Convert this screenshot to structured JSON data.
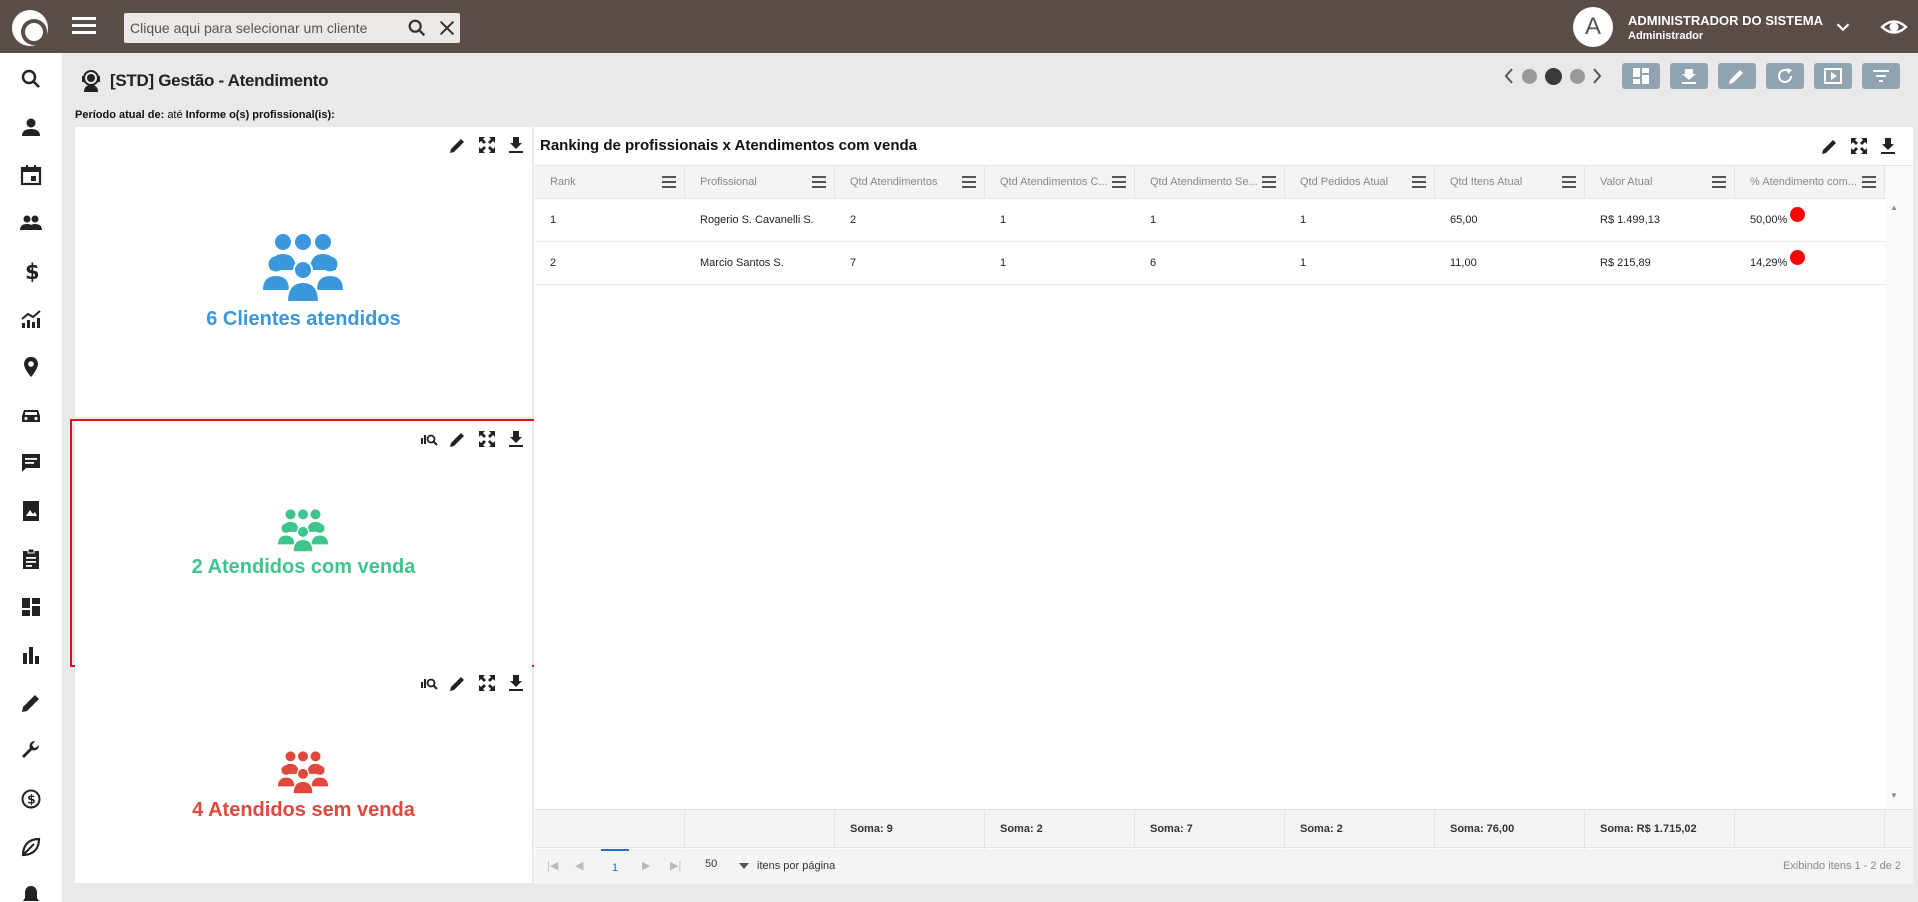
{
  "topbar": {
    "search_placeholder": "Clique aqui para selecionar um cliente",
    "avatar_letter": "A",
    "user_name": "ADMINISTRADOR DO SISTEMA",
    "user_role": "Administrador"
  },
  "header": {
    "title": "[STD] Gestão - Atendimento",
    "period_label": "Período atual de:",
    "period_until": "até",
    "professional_label": "Informe o(s) profissional(is):"
  },
  "kpis": [
    {
      "text": "6 Clientes atendidos",
      "color": "#3a97dc"
    },
    {
      "text": "2 Atendidos com venda",
      "color": "#3ec48d"
    },
    {
      "text": "4 Atendidos sem venda",
      "color": "#e0483d"
    }
  ],
  "table": {
    "title": "Ranking de profissionais x Atendimentos com venda",
    "columns": [
      "Rank",
      "Profissional",
      "Qtd Atendimentos",
      "Qtd Atendimentos C...",
      "Qtd Atendimento Se...",
      "Qtd Pedidos Atual",
      "Qtd Itens Atual",
      "Valor Atual",
      "% Atendimento com..."
    ],
    "rows": [
      [
        "1",
        "Rogerio S. Cavanelli S.",
        "2",
        "1",
        "1",
        "1",
        "65,00",
        "R$ 1.499,13",
        "50,00%"
      ],
      [
        "2",
        "Marcio Santos S.",
        "7",
        "1",
        "6",
        "1",
        "11,00",
        "R$ 215,89",
        "14,29%"
      ]
    ],
    "totals": [
      "",
      "",
      "Soma: 9",
      "Soma: 2",
      "Soma: 7",
      "Soma: 2",
      "Soma: 76,00",
      "Soma: R$ 1.715,02",
      ""
    ],
    "status_color": "#ff0000"
  },
  "pager": {
    "current_page": "1",
    "page_size": "50",
    "page_size_label": "itens por página",
    "info": "Exibindo itens 1 - 2 de 2"
  }
}
